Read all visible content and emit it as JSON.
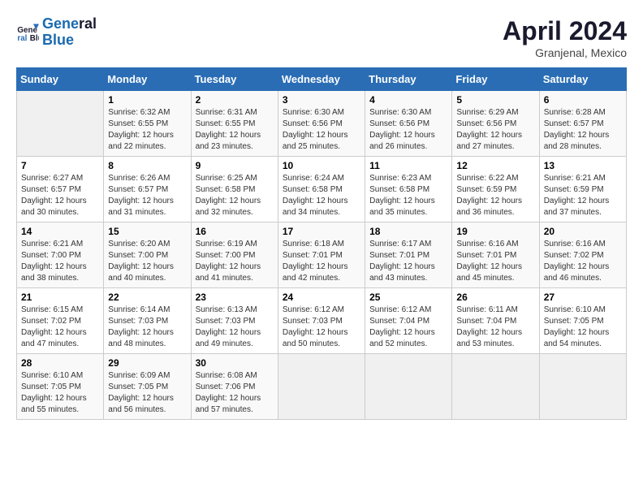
{
  "header": {
    "logo_line1": "General",
    "logo_line2": "Blue",
    "month": "April 2024",
    "location": "Granjenal, Mexico"
  },
  "weekdays": [
    "Sunday",
    "Monday",
    "Tuesday",
    "Wednesday",
    "Thursday",
    "Friday",
    "Saturday"
  ],
  "weeks": [
    [
      {
        "num": "",
        "empty": true
      },
      {
        "num": "1",
        "rise": "6:32 AM",
        "set": "6:55 PM",
        "daylight": "12 hours and 22 minutes."
      },
      {
        "num": "2",
        "rise": "6:31 AM",
        "set": "6:55 PM",
        "daylight": "12 hours and 23 minutes."
      },
      {
        "num": "3",
        "rise": "6:30 AM",
        "set": "6:56 PM",
        "daylight": "12 hours and 25 minutes."
      },
      {
        "num": "4",
        "rise": "6:30 AM",
        "set": "6:56 PM",
        "daylight": "12 hours and 26 minutes."
      },
      {
        "num": "5",
        "rise": "6:29 AM",
        "set": "6:56 PM",
        "daylight": "12 hours and 27 minutes."
      },
      {
        "num": "6",
        "rise": "6:28 AM",
        "set": "6:57 PM",
        "daylight": "12 hours and 28 minutes."
      }
    ],
    [
      {
        "num": "7",
        "rise": "6:27 AM",
        "set": "6:57 PM",
        "daylight": "12 hours and 30 minutes."
      },
      {
        "num": "8",
        "rise": "6:26 AM",
        "set": "6:57 PM",
        "daylight": "12 hours and 31 minutes."
      },
      {
        "num": "9",
        "rise": "6:25 AM",
        "set": "6:58 PM",
        "daylight": "12 hours and 32 minutes."
      },
      {
        "num": "10",
        "rise": "6:24 AM",
        "set": "6:58 PM",
        "daylight": "12 hours and 34 minutes."
      },
      {
        "num": "11",
        "rise": "6:23 AM",
        "set": "6:58 PM",
        "daylight": "12 hours and 35 minutes."
      },
      {
        "num": "12",
        "rise": "6:22 AM",
        "set": "6:59 PM",
        "daylight": "12 hours and 36 minutes."
      },
      {
        "num": "13",
        "rise": "6:21 AM",
        "set": "6:59 PM",
        "daylight": "12 hours and 37 minutes."
      }
    ],
    [
      {
        "num": "14",
        "rise": "6:21 AM",
        "set": "7:00 PM",
        "daylight": "12 hours and 38 minutes."
      },
      {
        "num": "15",
        "rise": "6:20 AM",
        "set": "7:00 PM",
        "daylight": "12 hours and 40 minutes."
      },
      {
        "num": "16",
        "rise": "6:19 AM",
        "set": "7:00 PM",
        "daylight": "12 hours and 41 minutes."
      },
      {
        "num": "17",
        "rise": "6:18 AM",
        "set": "7:01 PM",
        "daylight": "12 hours and 42 minutes."
      },
      {
        "num": "18",
        "rise": "6:17 AM",
        "set": "7:01 PM",
        "daylight": "12 hours and 43 minutes."
      },
      {
        "num": "19",
        "rise": "6:16 AM",
        "set": "7:01 PM",
        "daylight": "12 hours and 45 minutes."
      },
      {
        "num": "20",
        "rise": "6:16 AM",
        "set": "7:02 PM",
        "daylight": "12 hours and 46 minutes."
      }
    ],
    [
      {
        "num": "21",
        "rise": "6:15 AM",
        "set": "7:02 PM",
        "daylight": "12 hours and 47 minutes."
      },
      {
        "num": "22",
        "rise": "6:14 AM",
        "set": "7:03 PM",
        "daylight": "12 hours and 48 minutes."
      },
      {
        "num": "23",
        "rise": "6:13 AM",
        "set": "7:03 PM",
        "daylight": "12 hours and 49 minutes."
      },
      {
        "num": "24",
        "rise": "6:12 AM",
        "set": "7:03 PM",
        "daylight": "12 hours and 50 minutes."
      },
      {
        "num": "25",
        "rise": "6:12 AM",
        "set": "7:04 PM",
        "daylight": "12 hours and 52 minutes."
      },
      {
        "num": "26",
        "rise": "6:11 AM",
        "set": "7:04 PM",
        "daylight": "12 hours and 53 minutes."
      },
      {
        "num": "27",
        "rise": "6:10 AM",
        "set": "7:05 PM",
        "daylight": "12 hours and 54 minutes."
      }
    ],
    [
      {
        "num": "28",
        "rise": "6:10 AM",
        "set": "7:05 PM",
        "daylight": "12 hours and 55 minutes."
      },
      {
        "num": "29",
        "rise": "6:09 AM",
        "set": "7:05 PM",
        "daylight": "12 hours and 56 minutes."
      },
      {
        "num": "30",
        "rise": "6:08 AM",
        "set": "7:06 PM",
        "daylight": "12 hours and 57 minutes."
      },
      {
        "num": "",
        "empty": true
      },
      {
        "num": "",
        "empty": true
      },
      {
        "num": "",
        "empty": true
      },
      {
        "num": "",
        "empty": true
      }
    ]
  ],
  "labels": {
    "sunrise": "Sunrise:",
    "sunset": "Sunset:",
    "daylight": "Daylight:"
  }
}
